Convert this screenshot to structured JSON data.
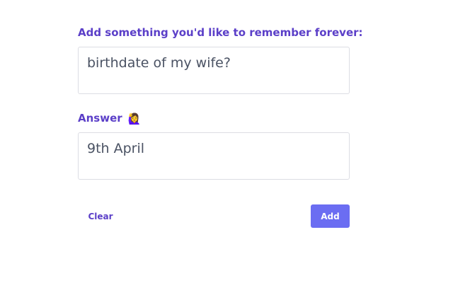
{
  "form": {
    "question_label": "Add something you'd like to remember forever:",
    "question_value": "birthdate of my wife?",
    "answer_label": "Answer",
    "answer_emoji": "🙋‍♀️",
    "answer_value": "9th April",
    "clear_label": "Clear",
    "add_label": "Add"
  },
  "colors": {
    "accent": "#5b3fc8",
    "button_bg": "#6b6df2",
    "input_border": "#dcdde3",
    "input_text": "#4a5263"
  }
}
